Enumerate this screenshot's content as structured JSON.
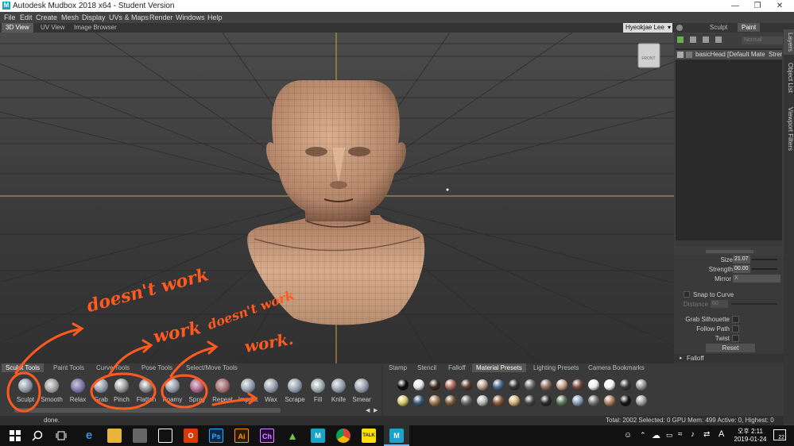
{
  "window": {
    "title": "Autodesk Mudbox 2018 x64 - Student Version",
    "app_icon": "M",
    "controls": [
      "minimize-icon",
      "maximize-icon",
      "close-icon"
    ]
  },
  "menu": [
    "File",
    "Edit",
    "Create",
    "Mesh",
    "Display",
    "UVs & Maps",
    "Render",
    "Windows",
    "Help"
  ],
  "view_tabs": {
    "items": [
      "3D View",
      "UV View",
      "Image Browser"
    ],
    "active": "3D View"
  },
  "user": {
    "name": "Hyeokjae Lee"
  },
  "viewport": {
    "cube_label": "FRONT"
  },
  "right_panel": {
    "tabs": [
      "Sculpt",
      "Paint"
    ],
    "blend_mode": "Normal",
    "layer": {
      "name": "basicHead [Default Mate",
      "col2": "Strer"
    },
    "properties": {
      "size_label": "Size",
      "size_value": "21.07",
      "strength_label": "Strength",
      "strength_value": "00.00",
      "mirror_label": "Mirror",
      "mirror_value": "X",
      "snap_label": "Snap to Curve",
      "distance_label": "Distance",
      "distance_value": "60",
      "grab_silhouette_label": "Grab Silhouette",
      "follow_path_label": "Follow Path",
      "twist_label": "Twist",
      "reset_label": "Reset",
      "falloff_label": "Falloff"
    }
  },
  "side_tabs": [
    "Layers",
    "Object List",
    "Viewport Filters"
  ],
  "tool_tabs": [
    "Sculpt Tools",
    "Paint Tools",
    "Curve Tools",
    "Pose Tools",
    "Select/Move Tools"
  ],
  "tools": [
    "Sculpt",
    "Smooth",
    "Relax",
    "Grab",
    "Pinch",
    "Flatten",
    "Foamy",
    "Spray",
    "Repeat",
    "Imprint",
    "Wax",
    "Scrape",
    "Fill",
    "Knife",
    "Smear"
  ],
  "preset_tabs": [
    "Stamp",
    "Stencil",
    "Falloff",
    "Material Presets",
    "Lighting Presets",
    "Camera Bookmarks"
  ],
  "active_preset_tab": "Material Presets",
  "materials_row1": [
    "#0d0d0d",
    "#e9e9e9",
    "#3c2a1e",
    "#b06f5c",
    "#5a4030",
    "#b9a28e",
    "#4a6a92",
    "#333333",
    "#6e6e6e",
    "#8f7461",
    "#c9a38a",
    "#7a4b3b",
    "#eeeeee",
    "#f8f8f8",
    "#3a3a3a",
    "#999999"
  ],
  "materials_row2": [
    "#d8c76a",
    "#3a5a7a",
    "#a07a4a",
    "#7a5a3a",
    "#6a6a6a",
    "#b8b8b8",
    "#8a5a3a",
    "#d4b07a",
    "#444444",
    "#2a2a2a",
    "#5a7a5a",
    "#8aa0b8",
    "#777777",
    "#b08060",
    "#151515",
    "#a0a0a0"
  ],
  "status": {
    "message": "done.",
    "info": "Total: 2002  Selected: 0 GPU Mem: 499  Active: 0, Highest: 0"
  },
  "annotations": {
    "doesnt_work_1": "doesn't work",
    "work_1": "work",
    "doesnt_work_2": "doesn't work",
    "work_2": "work.",
    "annotation_color": "#ff5a1f"
  },
  "taskbar": {
    "apps": [
      "start-icon",
      "search-icon",
      "task-view-icon",
      "edge-icon",
      "explorer-icon",
      "store-icon",
      "mail-icon",
      "office-icon",
      "photoshop-icon",
      "illustrator-icon",
      "character-animator-icon",
      "android-icon",
      "mudbox-icon",
      "chrome-icon",
      "kakaotalk-icon",
      "mudbox-active-icon"
    ],
    "app_labels": {
      "photoshop": "Ps",
      "illustrator": "Ai",
      "character_animator": "Ch",
      "mudbox": "M",
      "kakaotalk": "TALK",
      "office": "O"
    },
    "ime": "A",
    "time": "오후 2:11",
    "date": "2019-01-24",
    "notifications": "22"
  },
  "colors": {
    "accent": "#5a5a5a",
    "skin": "#c89a7a",
    "axis": "#c9a44a"
  }
}
